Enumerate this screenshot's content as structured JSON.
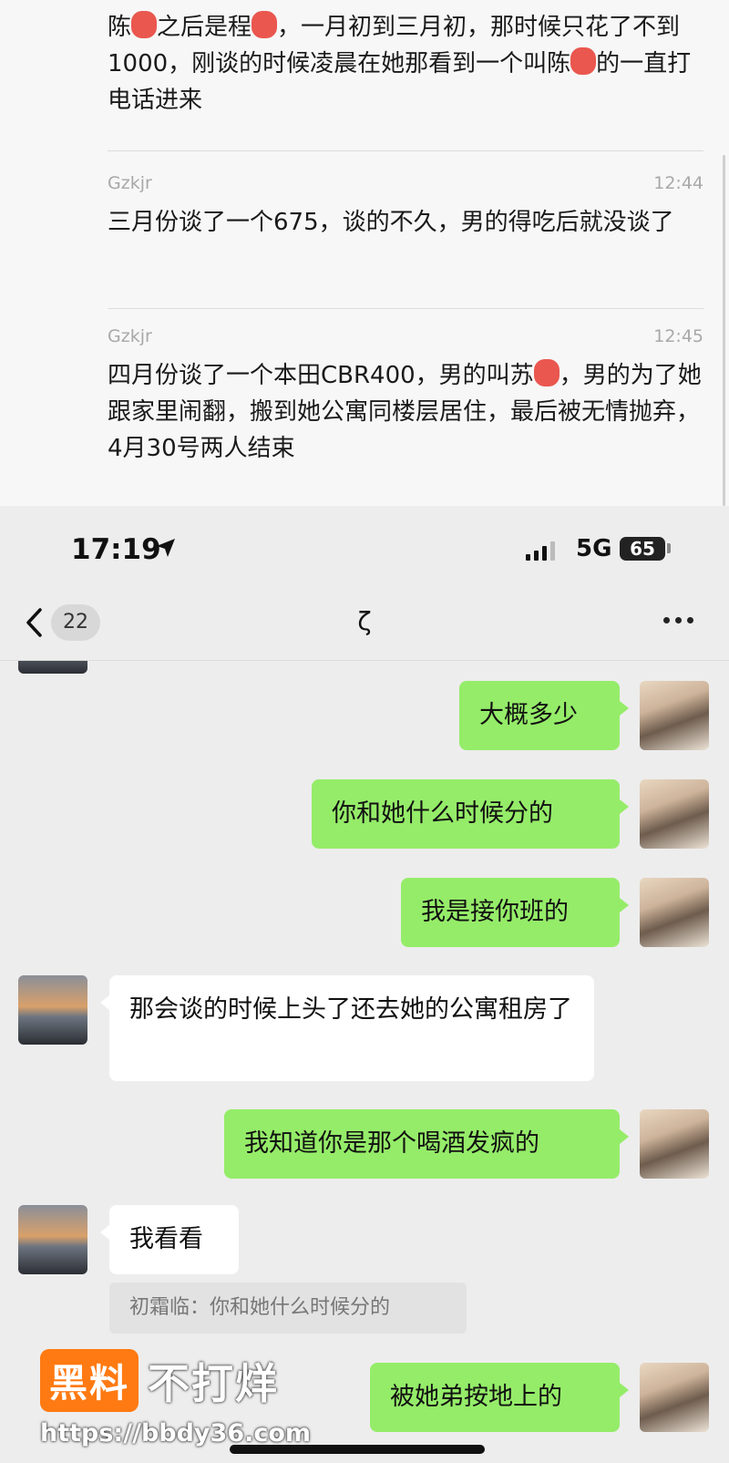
{
  "record": {
    "item1_text_a": "陈",
    "item1_text_b": "之后是程",
    "item1_text_c": "，一月初到三月初，那时候只花了不到1000，刚谈的时候凌晨在她那看到一个叫陈",
    "item1_text_d": "的一直打电话进来",
    "item2_sender": "Gzkjr",
    "item2_time": "12:44",
    "item2_text": "三月份谈了一个675，谈的不久，男的得吃后就没谈了",
    "item3_sender": "Gzkjr",
    "item3_time": "12:45",
    "item3_text_a": "四月份谈了一个本田CBR400，男的叫苏",
    "item3_text_b": "，男的为了她跟家里闹翻，搬到她公寓同楼层居住，最后被无情抛弃，4月30号两人结束"
  },
  "statusbar": {
    "time": "17:19",
    "network": "5G",
    "battery": "65"
  },
  "navbar": {
    "unread_count": "22",
    "title": "ζ"
  },
  "chat": {
    "messages": [
      {
        "side": "right",
        "text": "大概多少"
      },
      {
        "side": "right",
        "text": "你和她什么时候分的"
      },
      {
        "side": "right",
        "text": "我是接你班的"
      },
      {
        "side": "left",
        "text": "那会谈的时候上头了还去她的公寓租房了"
      },
      {
        "side": "right",
        "text": "我知道你是那个喝酒发疯的"
      },
      {
        "side": "left",
        "text": "我看看"
      },
      {
        "side": "right",
        "text": "被她弟按地上的"
      }
    ],
    "quote": "初霜临：你和她什么时候分的"
  },
  "watermark": {
    "brand_box": "黑料",
    "brand_rest": "不打烊",
    "url": "https://bbdy36.com"
  },
  "colors": {
    "my_bubble": "#95ec69",
    "their_bubble": "#ffffff",
    "background": "#ededed",
    "watermark_orange": "#ff7a12"
  }
}
